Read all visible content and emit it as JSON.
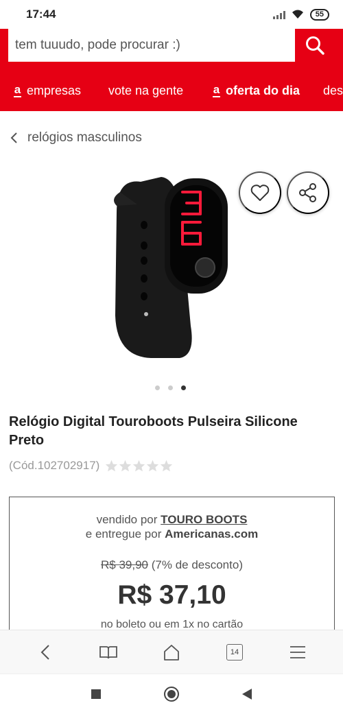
{
  "status": {
    "time": "17:44",
    "battery": "55"
  },
  "search": {
    "placeholder": "tem tuuudo, pode procurar :)"
  },
  "nav": {
    "items": [
      {
        "label": "empresas",
        "has_logo": true
      },
      {
        "label": "vote na gente",
        "has_logo": false
      },
      {
        "label": "oferta do dia",
        "has_logo": true
      },
      {
        "label": "des",
        "has_logo": false
      }
    ]
  },
  "breadcrumb": {
    "label": "relógios masculinos"
  },
  "product": {
    "title": "Relógio Digital Touroboots Pulseira Silicone Preto",
    "code": "(Cód.102702917)",
    "rating": 0,
    "image_index": 3,
    "image_count": 3
  },
  "buy_box": {
    "sold_by_prefix": "vendido por",
    "seller": "TOURO BOOTS",
    "delivered_by_prefix": "e entregue por",
    "deliverer": "Americanas.com",
    "old_price": "R$ 39,90",
    "discount": "(7% de desconto)",
    "price": "R$ 37,10",
    "payment": "no boleto ou em 1x no cartão"
  },
  "browser": {
    "tab_count": "14"
  },
  "colors": {
    "brand": "#e60014"
  }
}
